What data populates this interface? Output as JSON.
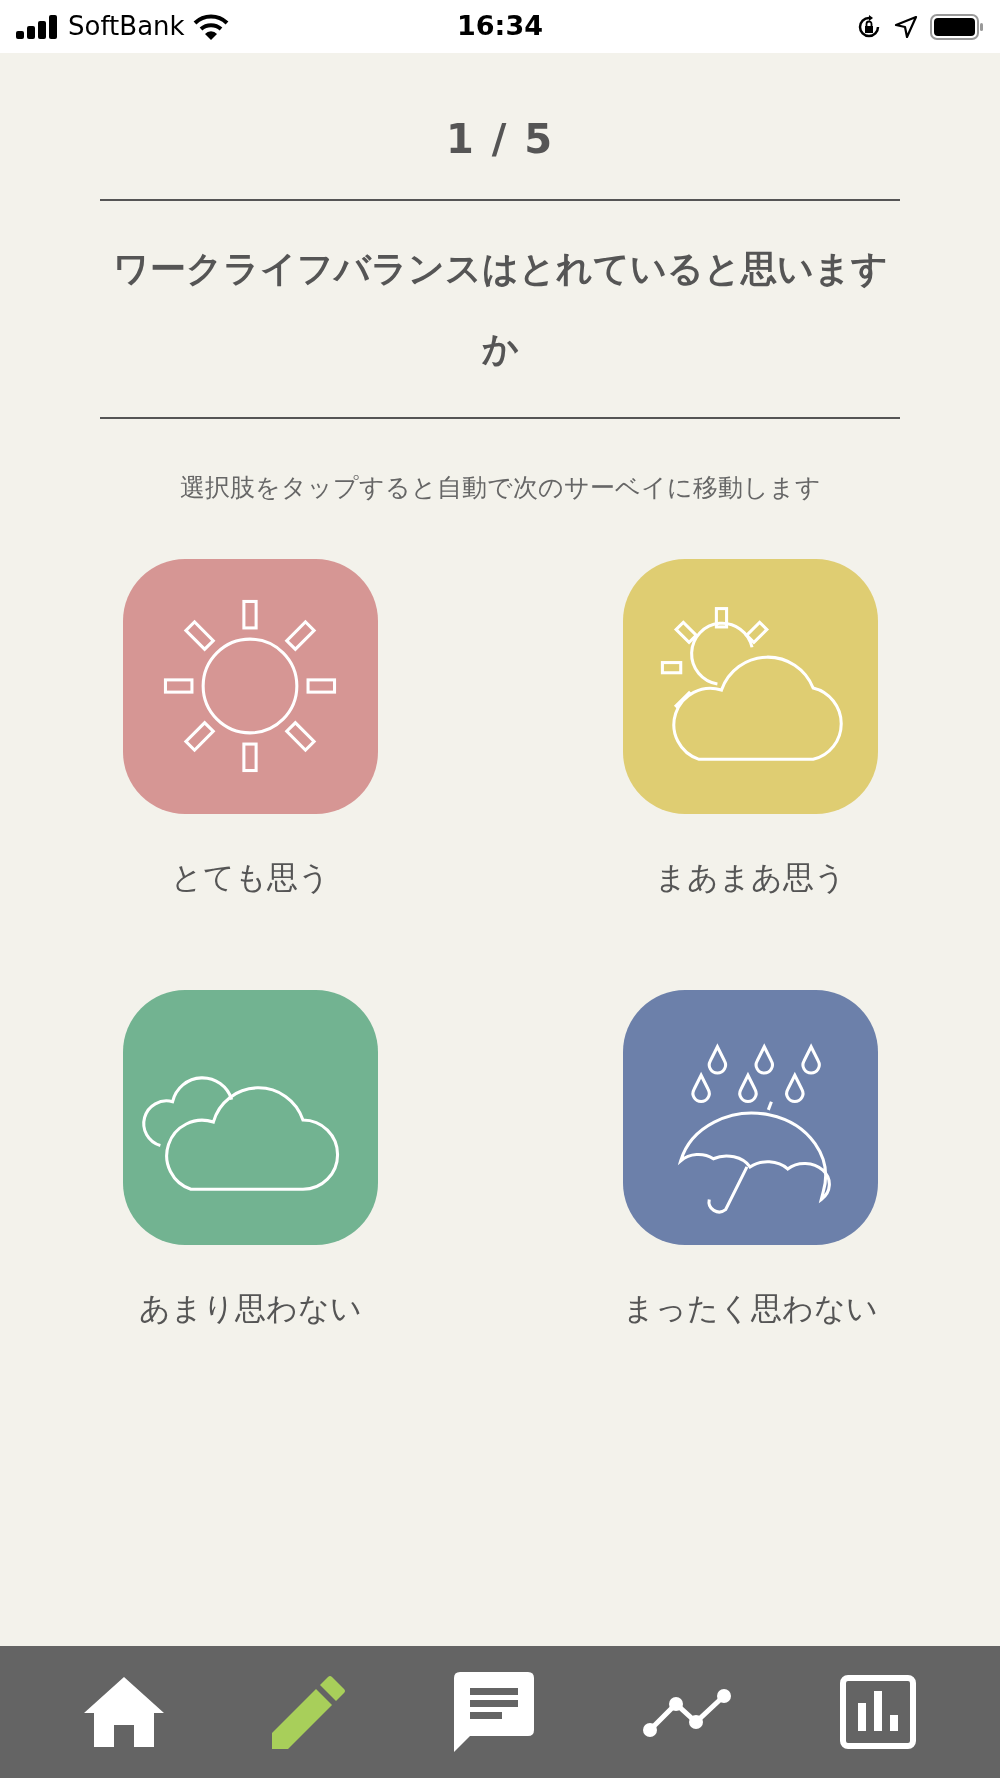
{
  "status_bar": {
    "carrier": "SoftBank",
    "time": "16:34"
  },
  "progress": "1 / 5",
  "question": "ワークライフバランスはとれていると思いますか",
  "instruction": "選択肢をタップすると自動で次のサーベイに移動します",
  "options": [
    {
      "label": "とても思う",
      "kind": "sunny",
      "color": "#d69694"
    },
    {
      "label": "まあまあ思う",
      "kind": "partly_cloudy",
      "color": "#dfcd72"
    },
    {
      "label": "あまり思わない",
      "kind": "cloudy",
      "color": "#72b391"
    },
    {
      "label": "まったく思わない",
      "kind": "rain",
      "color": "#6c80aa"
    }
  ],
  "tab_bar": [
    {
      "kind": "home",
      "selected": false
    },
    {
      "kind": "pencil",
      "selected": true
    },
    {
      "kind": "message",
      "selected": false
    },
    {
      "kind": "trend",
      "selected": false
    },
    {
      "kind": "report",
      "selected": false
    }
  ]
}
